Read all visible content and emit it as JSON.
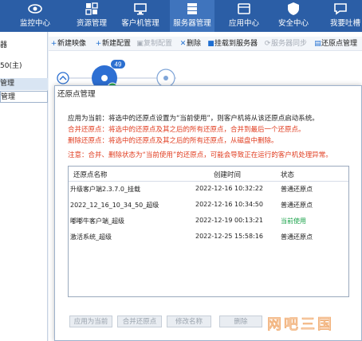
{
  "nav": {
    "items": [
      {
        "label": "监控中心",
        "icon": "eye-icon"
      },
      {
        "label": "资源管理",
        "icon": "resources-icon"
      },
      {
        "label": "客户机管理",
        "icon": "client-monitor-icon"
      },
      {
        "label": "服务器管理",
        "icon": "server-icon"
      },
      {
        "label": "应用中心",
        "icon": "app-center-icon"
      },
      {
        "label": "安全中心",
        "icon": "shield-icon"
      },
      {
        "label": "我要吐槽",
        "icon": "feedback-icon"
      }
    ],
    "active_index": 3
  },
  "left_panel": {
    "items": [
      "器",
      "50(主)",
      "管理",
      "管理"
    ]
  },
  "toolbar": {
    "new_image": "新建映像",
    "new_config": "新建配置",
    "copy_config": "复制配置",
    "delete": "删除",
    "mount_server": "挂载到服务器",
    "server_sync": "服务器同步",
    "restore_manage": "还原点管理"
  },
  "diagram": {
    "badge": "49"
  },
  "dialog": {
    "title": "还原点管理",
    "msg1": "应用为当前：将选中的还原点设置为“当前使用”，则客户机将从该还原点启动系统。",
    "msg2": "合并还原点：将选中的还原点及其之后的所有还原点，合并到最后一个还原点。",
    "msg3": "删除还原点：将选中的还原点及其之后的所有还原点，从磁盘中删除。",
    "msg4": "注意：合并、删除状态为“当前使用”的还原点，可能会导致正在运行的客户机处理异常。",
    "columns": [
      "还原点名称",
      "创建时间",
      "状态"
    ],
    "rows": [
      {
        "name": "升级客户端2.3.7.0_挂载",
        "time": "2022-12-16 10:32:22",
        "status": "普通还原点",
        "current": false
      },
      {
        "name": "2022_12_16_10_34_50_超级",
        "time": "2022-12-16 10:34:50",
        "status": "普通还原点",
        "current": false
      },
      {
        "name": "嘟嘟牛客户端_超级",
        "time": "2022-12-19 00:13:21",
        "status": "当前使用",
        "current": true
      },
      {
        "name": "激活系统_超级",
        "time": "2022-12-25 15:58:16",
        "status": "普通还原点",
        "current": false
      }
    ],
    "buttons": {
      "apply": "应用为当前",
      "merge": "合并还原点",
      "rename": "修改名称",
      "delete": "删除"
    }
  },
  "watermark": {
    "text": "网吧三国"
  },
  "colors": {
    "nav_bg": "#2b5ea6",
    "status_current": "#1aa24a",
    "warning_red": "#e03c1f",
    "accent_blue": "#1f6fd1"
  }
}
